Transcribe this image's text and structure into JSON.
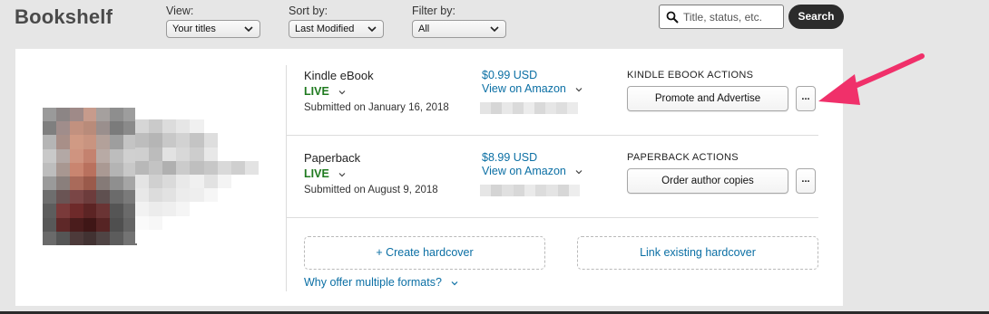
{
  "header": {
    "title": "Bookshelf",
    "view": {
      "label": "View:",
      "selected": "Your titles"
    },
    "sort": {
      "label": "Sort by:",
      "selected": "Last Modified"
    },
    "filter": {
      "label": "Filter by:",
      "selected": "All"
    },
    "search": {
      "placeholder": "Title, status, etc.",
      "button_label": "Search"
    }
  },
  "formats": [
    {
      "name": "Kindle eBook",
      "status": "LIVE",
      "submitted": "Submitted on January 16, 2018",
      "price": "$0.99 USD",
      "view_link": "View on Amazon",
      "actions_label": "KINDLE EBOOK ACTIONS",
      "action_button": "Promote and Advertise",
      "more_label": "..."
    },
    {
      "name": "Paperback",
      "status": "LIVE",
      "submitted": "Submitted on August 9, 2018",
      "price": "$8.99 USD",
      "view_link": "View on Amazon",
      "actions_label": "PAPERBACK ACTIONS",
      "action_button": "Order author copies",
      "more_label": "..."
    }
  ],
  "hardcover": {
    "create_label": "+ Create hardcover",
    "link_label": "Link existing hardcover",
    "why_label": "Why offer multiple formats?"
  },
  "colors": {
    "live_green": "#1f7a1f",
    "link_blue": "#0b6fa4",
    "search_button": "#2b2b2b",
    "annotation_arrow": "#f0306a"
  },
  "icons": {
    "search": "search-icon",
    "dropdown": "chevron-down-icon",
    "annotation": "arrow-annotation-icon"
  }
}
